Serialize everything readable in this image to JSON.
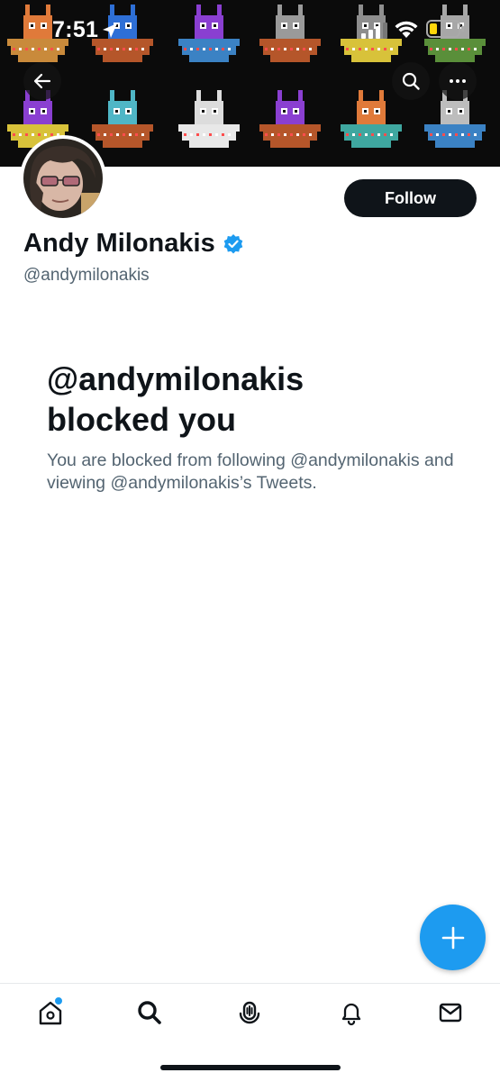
{
  "status_bar": {
    "time": "7:51"
  },
  "header": {
    "back_icon": "arrow-left-icon",
    "search_icon": "search-icon",
    "more_icon": "more-horizontal-icon"
  },
  "profile": {
    "display_name": "Andy Milonakis",
    "handle": "@andymilonakis",
    "verified": true,
    "follow_label": "Follow"
  },
  "blocked": {
    "title_line1": "@andymilonakis",
    "title_line2": "blocked you",
    "message": "You are blocked from following @andymilonakis and viewing @andymilonakis’s Tweets."
  },
  "bottom_nav": {
    "items": [
      {
        "icon": "home-icon",
        "has_dot": true
      },
      {
        "icon": "search-icon"
      },
      {
        "icon": "spaces-icon"
      },
      {
        "icon": "bell-icon"
      },
      {
        "icon": "mail-icon"
      }
    ]
  },
  "colors": {
    "accent": "#1d9bf0",
    "text_primary": "#0f1419",
    "text_secondary": "#536471",
    "follow_button": "#0f1419"
  }
}
